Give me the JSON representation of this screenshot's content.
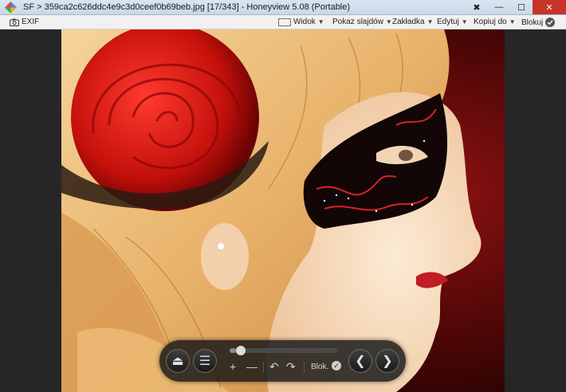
{
  "window": {
    "title": "SF > 359ca2c626ddc4e9c3d0ceef0b69beb.jpg [17/343] - Honeyview 5.08 (Portable)",
    "pin_glyph": "✖",
    "minimize_glyph": "—",
    "maximize_glyph": "☐",
    "close_glyph": "✕"
  },
  "toolbar": {
    "exif_label": "EXIF",
    "view_label": "Widok",
    "slideshow_label": "Pokaz slajdów",
    "bookmark_label": "Zakładka",
    "edit_label": "Edytuj",
    "copy_label": "Kopiuj do",
    "lock_label": "Blokuj",
    "caret": "▼"
  },
  "controls": {
    "progress": 0.06,
    "eject_glyph": "⏏",
    "menu_glyph": "☰",
    "zoom_in_glyph": "+",
    "zoom_out_glyph": "—",
    "rotate_left_glyph": "↶",
    "rotate_right_glyph": "↷",
    "lock_label": "Blok.",
    "lock_glyph": "✓",
    "prev_glyph": "❮",
    "next_glyph": "❯"
  },
  "colors": {
    "accent_blue": "#3a7bd5",
    "close_red": "#c6342a"
  }
}
